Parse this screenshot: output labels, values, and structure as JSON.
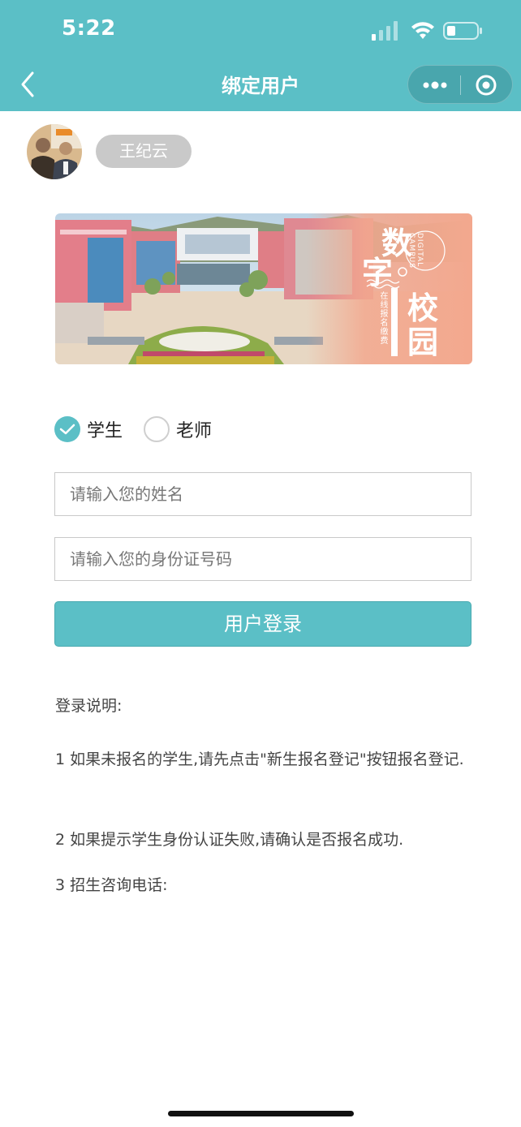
{
  "status_bar": {
    "time": "5:22"
  },
  "nav": {
    "title": "绑定用户",
    "back_icon": "chevron-left-icon",
    "more_icon": "more-dots-icon",
    "close_icon": "target-icon"
  },
  "user": {
    "name": "王纪云"
  },
  "banner": {
    "title_chars": [
      "数",
      "字",
      "校",
      "园"
    ],
    "subtitle": "在线报名缴费",
    "english": "DIGITAL CAMPUS"
  },
  "roles": [
    {
      "label": "学生",
      "selected": true
    },
    {
      "label": "老师",
      "selected": false
    }
  ],
  "form": {
    "name_placeholder": "请输入您的姓名",
    "id_placeholder": "请输入您的身份证号码",
    "login_label": "用户登录"
  },
  "instructions": {
    "title": "登录说明:",
    "items": [
      "1   如果未报名的学生,请先点击\"新生报名登记\"按钮报名登记.",
      "2   如果提示学生身份认证失败,请确认是否报名成功.",
      "3   招生咨询电话:"
    ]
  },
  "colors": {
    "accent": "#5bbfc6",
    "banner_peach": "#f3a88e"
  }
}
